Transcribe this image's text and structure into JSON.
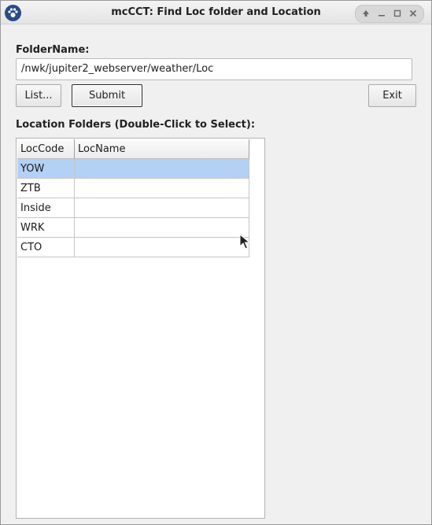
{
  "window": {
    "title": "mcCCT: Find Loc folder and Location"
  },
  "form": {
    "folder_label": "FolderName:",
    "folder_value": "/nwk/jupiter2_webserver/weather/Loc",
    "list_button": "List...",
    "submit_button": "Submit",
    "exit_button": "Exit",
    "table_label": "Location Folders (Double-Click to Select):"
  },
  "table": {
    "columns": [
      "LocCode",
      "LocName"
    ],
    "rows": [
      {
        "code": "YOW",
        "name": "",
        "selected": true
      },
      {
        "code": "ZTB",
        "name": ""
      },
      {
        "code": "Inside",
        "name": ""
      },
      {
        "code": "WRK",
        "name": ""
      },
      {
        "code": "CTO",
        "name": ""
      }
    ]
  },
  "colors": {
    "selection": "#b3d1f5",
    "app_icon": "#2a4a8a"
  },
  "icons": [
    "app-paw-icon",
    "window-up-icon",
    "window-minimize-icon",
    "window-maximize-icon",
    "window-close-icon",
    "mouse-pointer-icon"
  ]
}
